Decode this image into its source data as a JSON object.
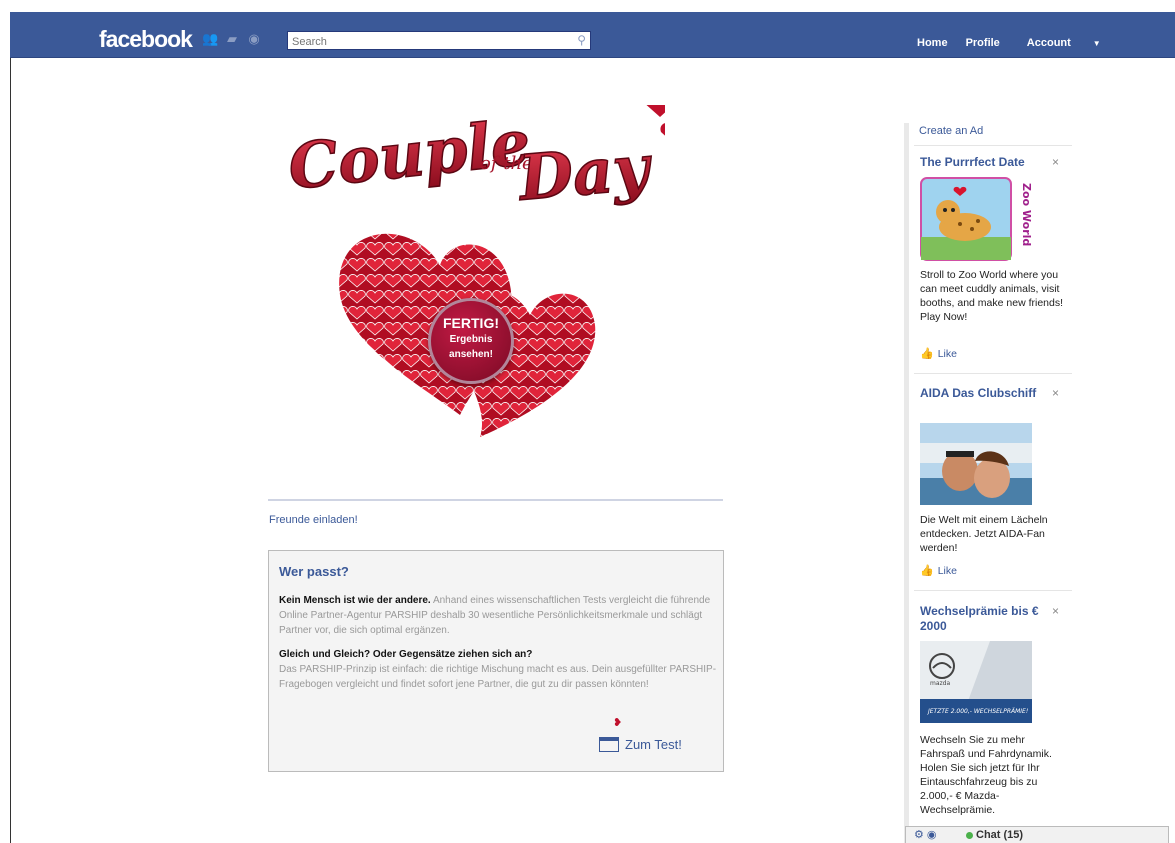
{
  "header": {
    "logo": "facebook",
    "search_placeholder": "Search",
    "nav": {
      "home": "Home",
      "profile": "Profile",
      "account": "Account"
    }
  },
  "app": {
    "title_art": "Couple of the Day",
    "badge": {
      "line1": "FERTIG!",
      "line2": "Ergebnis",
      "line3": "ansehen!"
    },
    "invite_link": "Freunde einladen!",
    "box": {
      "heading": "Wer passt?",
      "p1_bold": "Kein Mensch ist wie der andere.",
      "p1_rest": " Anhand eines wissenschaftlichen Tests vergleicht die führende Online Partner-Agentur PARSHIP deshalb 30 wesentliche Persönlichkeitsmerkmale und schlägt Partner vor, die sich optimal ergänzen.",
      "p2_bold": "Gleich und Gleich? Oder Gegensätze ziehen sich an?",
      "p2_rest": "Das PARSHIP-Prinzip ist einfach: die richtige Mischung macht es aus. Dein ausgefüllter PARSHIP-Fragebogen vergleicht und findet sofort jene Partner, die gut zu dir passen könnten!",
      "cta": "Zum Test!"
    }
  },
  "sidebar": {
    "create_ad": "Create an Ad",
    "ads": [
      {
        "title": "The Purrrfect Date",
        "img_text": "Zoo World",
        "text": "Stroll to Zoo World where you can meet cuddly animals, visit booths, and make new friends! Play Now!",
        "like": "Like"
      },
      {
        "title": "AIDA Das Clubschiff",
        "text": "Die Welt mit einem Lächeln entdecken. Jetzt AIDA-Fan werden!",
        "like": "Like"
      },
      {
        "title": "Wechselprämie bis € 2000",
        "img_brand": "mazda",
        "img_text": "JETZTE 2.000,- WECHSELPRÄMIE!",
        "text": "Wechseln Sie zu mehr Fahrspaß und Fahrdynamik. Holen Sie sich jetzt für Ihr Eintauschfahrzeug bis zu 2.000,- € Mazda-Wechselprämie."
      }
    ],
    "close_glyph": "×"
  },
  "chat": {
    "label": "Chat (15)"
  },
  "colors": {
    "fb_blue": "#3b5998",
    "heart_red": "#c0102c"
  }
}
